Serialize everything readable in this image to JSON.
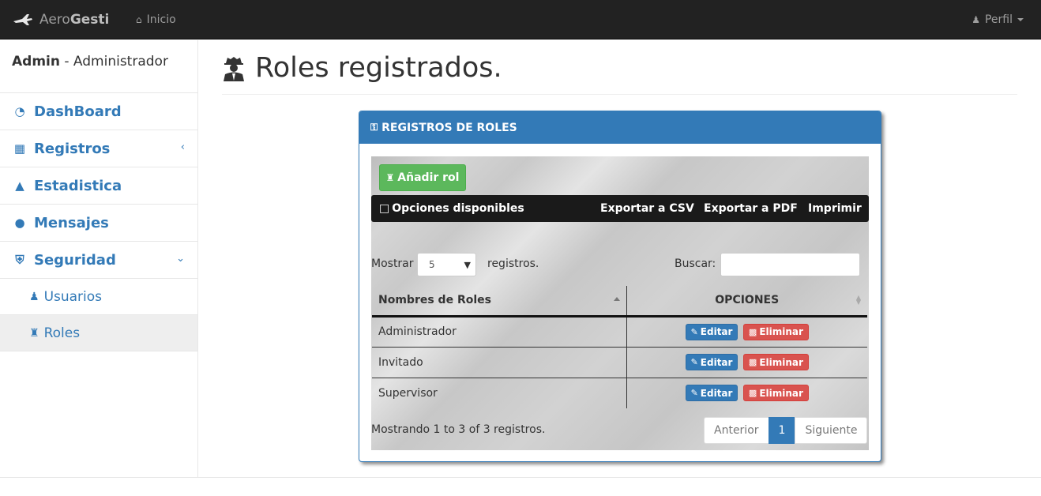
{
  "navbar": {
    "brand_part1": "Aero",
    "brand_part2": "Gesti",
    "brand_icon": "plane-icon",
    "home_label": "Inicio",
    "home_icon": "home-icon",
    "profile_label": "Perfil",
    "profile_icon": "user-icon"
  },
  "sidebar": {
    "user_name": "Admin",
    "user_role": " - Administrador",
    "items": [
      {
        "label": "DashBoard",
        "icon": "dashboard-icon"
      },
      {
        "label": "Registros",
        "icon": "table-icon"
      },
      {
        "label": "Estadistica",
        "icon": "area-chart-icon"
      },
      {
        "label": "Mensajes",
        "icon": "comment-icon"
      },
      {
        "label": "Seguridad",
        "icon": "shield-icon"
      }
    ],
    "subitems": [
      {
        "label": "Usuarios",
        "icon": "users-icon"
      },
      {
        "label": "Roles",
        "icon": "user-secret-icon"
      }
    ]
  },
  "page": {
    "title": "Roles registrados."
  },
  "panel": {
    "heading": "REGISTROS DE ROLES",
    "add_button": "Añadir rol",
    "options_label": "Opciones disponibles",
    "export_csv": "Exportar a CSV",
    "export_pdf": "Exportar a PDF",
    "print": "Imprimir",
    "show_label": "Mostrar",
    "show_value": "5",
    "show_suffix": "registros.",
    "search_label": "Buscar:",
    "search_value": "",
    "columns": [
      "Nombres de Roles",
      "OPCIONES"
    ],
    "rows": [
      {
        "name": "Administrador"
      },
      {
        "name": "Invitado"
      },
      {
        "name": "Supervisor"
      }
    ],
    "edit_label": "Editar",
    "delete_label": "Eliminar",
    "info": "Mostrando 1 to 3 of 3 registros.",
    "pager_prev": "Anterior",
    "pager_current": "1",
    "pager_next": "Siguiente"
  },
  "colors": {
    "navbar_bg": "#222222",
    "primary": "#337ab7",
    "success": "#5cb85c",
    "danger": "#d9534f"
  }
}
